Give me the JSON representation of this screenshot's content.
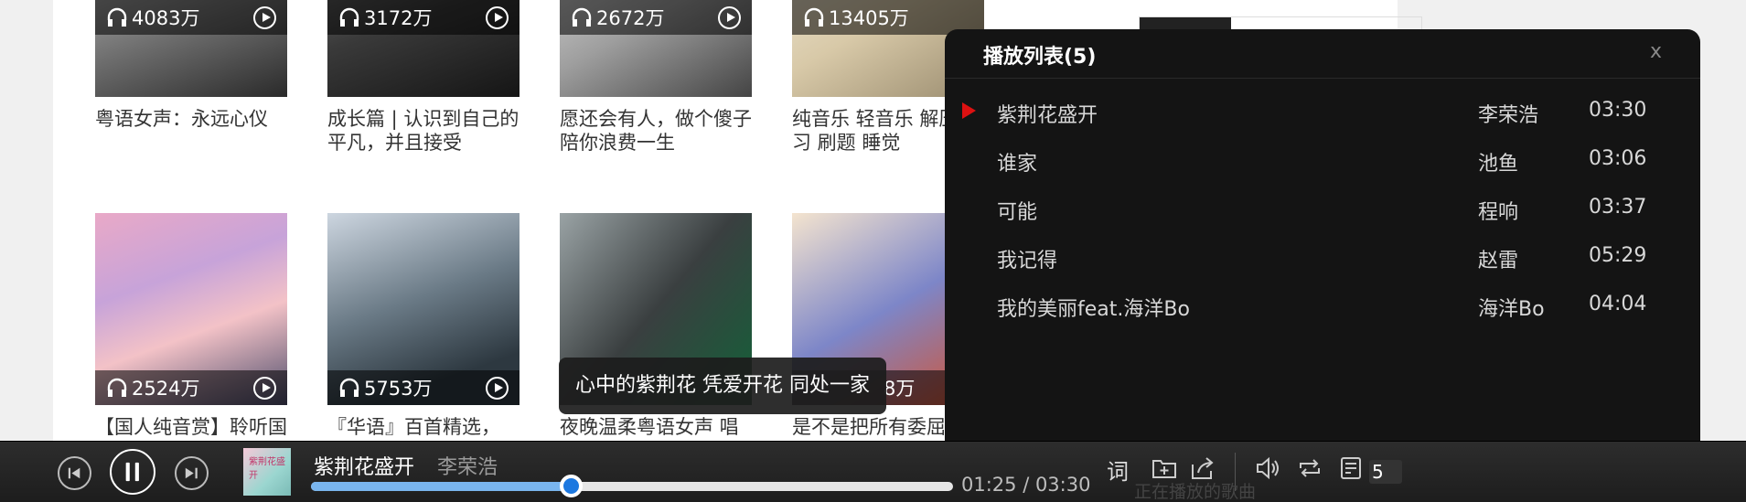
{
  "grid": {
    "row1": [
      {
        "count": "4083万",
        "title": "粤语女声：永远心仪"
      },
      {
        "count": "3172万",
        "title": "成长篇 | 认识到自己的平凡，并且接受"
      },
      {
        "count": "2672万",
        "title": "愿还会有人，做个傻子陪你浪费一生"
      },
      {
        "count": "13405万",
        "title": "纯音乐 轻音乐 解压 学习 刷题 睡觉"
      }
    ],
    "row2": [
      {
        "count": "2524万",
        "title": "【国人纯音赏】聆听国人纯音"
      },
      {
        "count": "5753万",
        "title": "『华语』百首精选，"
      },
      {
        "count": "8万",
        "title": "夜晚温柔粤语女声 唱出他的不眠心事"
      },
      {
        "count": "",
        "title": "是不是把所有委屈咽下，才显得懂事"
      }
    ]
  },
  "playlist": {
    "title": "播放列表(5)",
    "close_label": "x",
    "items": [
      {
        "name": "紫荆花盛开",
        "artist": "李荣浩",
        "duration": "03:30"
      },
      {
        "name": "谁家",
        "artist": "池鱼",
        "duration": "03:06"
      },
      {
        "name": "可能",
        "artist": "程响",
        "duration": "03:37"
      },
      {
        "name": "我记得",
        "artist": "赵雷",
        "duration": "05:29"
      },
      {
        "name": "我的美丽feat.海洋Bo",
        "artist": "海洋Bo",
        "duration": "04:04"
      }
    ]
  },
  "lyric_tooltip": "心中的紫荆花 凭爱开花 同处一家",
  "player": {
    "song": "紫荆花盛开",
    "artist": "李荣浩",
    "thumb_text": "紫荆花盛开",
    "time": "01:25 / 03:30",
    "progress": 0.405,
    "lyric_label": "词",
    "queue_count": "5",
    "ghost_text": "正在播放的歌曲"
  },
  "colors": {
    "accent": "#1c78e0",
    "progress_fill": "#79b5ee",
    "playing_marker": "#dd1111",
    "panel_bg": "#141414"
  },
  "icons": [
    "headphone-icon",
    "play-circle-icon",
    "prev-icon",
    "pause-icon",
    "next-icon",
    "add-to-folder-icon",
    "share-icon",
    "volume-icon",
    "repeat-icon",
    "queue-icon",
    "close-icon"
  ]
}
